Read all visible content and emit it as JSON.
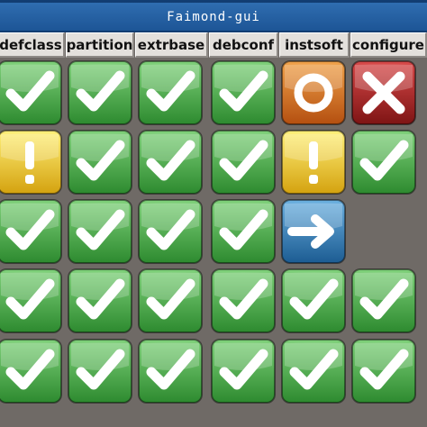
{
  "window": {
    "title": "Faimond-gui"
  },
  "columns": [
    {
      "label": "defclass"
    },
    {
      "label": "partition"
    },
    {
      "label": "extrbase"
    },
    {
      "label": "debconf"
    },
    {
      "label": "instsoft"
    },
    {
      "label": "configure"
    }
  ],
  "rows": [
    [
      "success",
      "success",
      "success",
      "success",
      "error",
      "failed"
    ],
    [
      "warning",
      "success",
      "success",
      "success",
      "warning",
      "success"
    ],
    [
      "success",
      "success",
      "success",
      "success",
      "running",
      "none"
    ],
    [
      "success",
      "success",
      "success",
      "success",
      "success",
      "success"
    ],
    [
      "success",
      "success",
      "success",
      "success",
      "success",
      "success"
    ]
  ],
  "status_styles": {
    "success": {
      "icon": "check-icon",
      "color_top": "#7fd17a",
      "color_bottom": "#2d8a2f"
    },
    "warning": {
      "icon": "exclamation-icon",
      "color_top": "#fff07a",
      "color_bottom": "#d4a20f"
    },
    "error": {
      "icon": "circle-icon",
      "color_top": "#f0a24a",
      "color_bottom": "#b44f10"
    },
    "failed": {
      "icon": "cross-icon",
      "color_top": "#d84a4a",
      "color_bottom": "#7e1414"
    },
    "running": {
      "icon": "arrow-right-icon",
      "color_top": "#6bb0e0",
      "color_bottom": "#1c5c92"
    }
  }
}
